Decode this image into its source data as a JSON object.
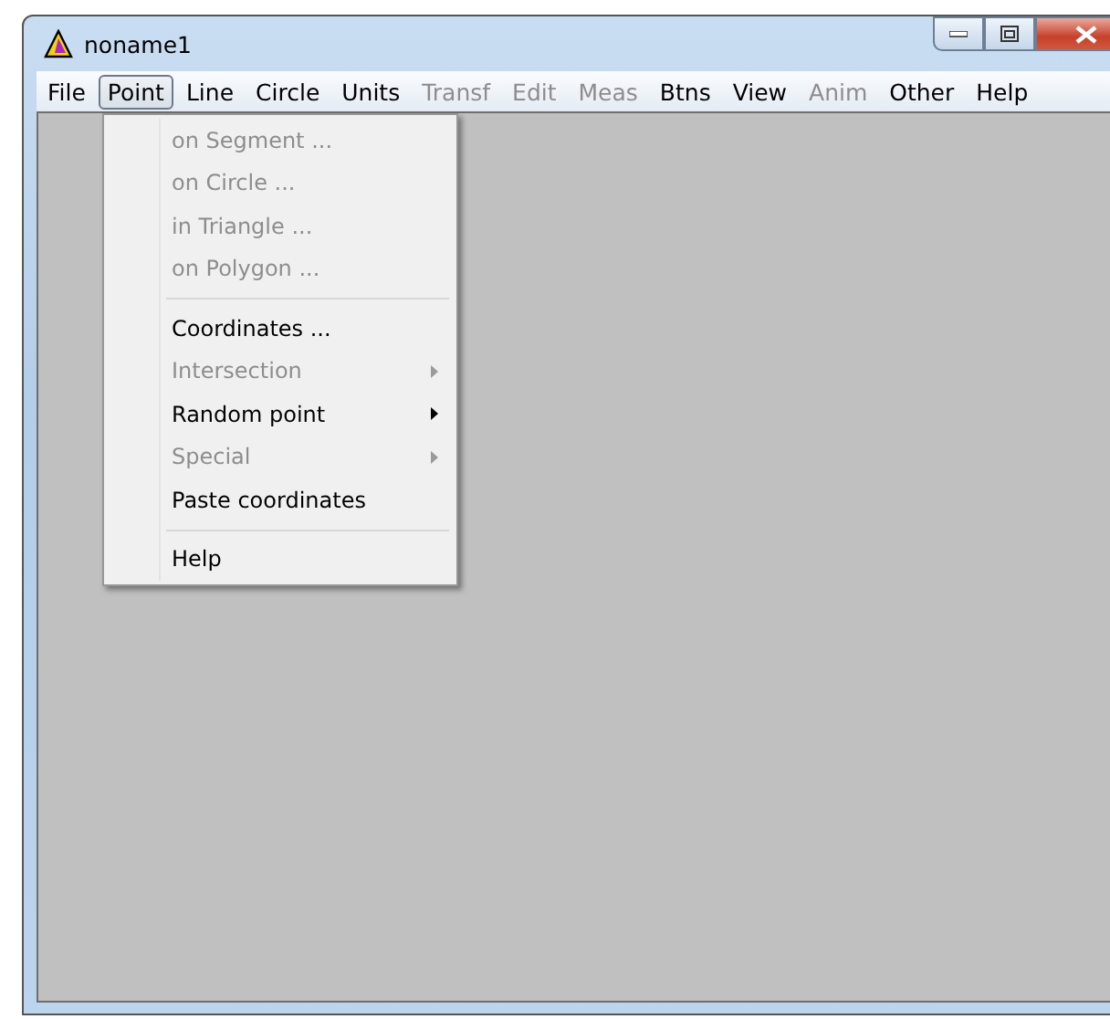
{
  "window": {
    "title": "noname1"
  },
  "menu_bar": [
    {
      "label": "File",
      "selected": false,
      "disabled": false
    },
    {
      "label": "Point",
      "selected": true,
      "disabled": false
    },
    {
      "label": "Line",
      "selected": false,
      "disabled": false
    },
    {
      "label": "Circle",
      "selected": false,
      "disabled": false
    },
    {
      "label": "Units",
      "selected": false,
      "disabled": false
    },
    {
      "label": "Transf",
      "selected": false,
      "disabled": true
    },
    {
      "label": "Edit",
      "selected": false,
      "disabled": true
    },
    {
      "label": "Meas",
      "selected": false,
      "disabled": true
    },
    {
      "label": "Btns",
      "selected": false,
      "disabled": false
    },
    {
      "label": "View",
      "selected": false,
      "disabled": false
    },
    {
      "label": "Anim",
      "selected": false,
      "disabled": true
    },
    {
      "label": "Other",
      "selected": false,
      "disabled": false
    },
    {
      "label": "Help",
      "selected": false,
      "disabled": false
    }
  ],
  "point_menu": [
    {
      "kind": "item",
      "label": "on Segment ...",
      "disabled": true,
      "submenu": false
    },
    {
      "kind": "item",
      "label": "on Circle ...",
      "disabled": true,
      "submenu": false
    },
    {
      "kind": "item",
      "label": "in Triangle ...",
      "disabled": true,
      "submenu": false
    },
    {
      "kind": "item",
      "label": "on Polygon ...",
      "disabled": true,
      "submenu": false
    },
    {
      "kind": "separator"
    },
    {
      "kind": "item",
      "label": "Coordinates ...",
      "disabled": false,
      "submenu": false
    },
    {
      "kind": "item",
      "label": "Intersection",
      "disabled": true,
      "submenu": true
    },
    {
      "kind": "item",
      "label": "Random point",
      "disabled": false,
      "submenu": true
    },
    {
      "kind": "item",
      "label": "Special",
      "disabled": true,
      "submenu": true
    },
    {
      "kind": "item",
      "label": "Paste coordinates",
      "disabled": false,
      "submenu": false
    },
    {
      "kind": "separator"
    },
    {
      "kind": "item",
      "label": "Help",
      "disabled": false,
      "submenu": false
    }
  ]
}
